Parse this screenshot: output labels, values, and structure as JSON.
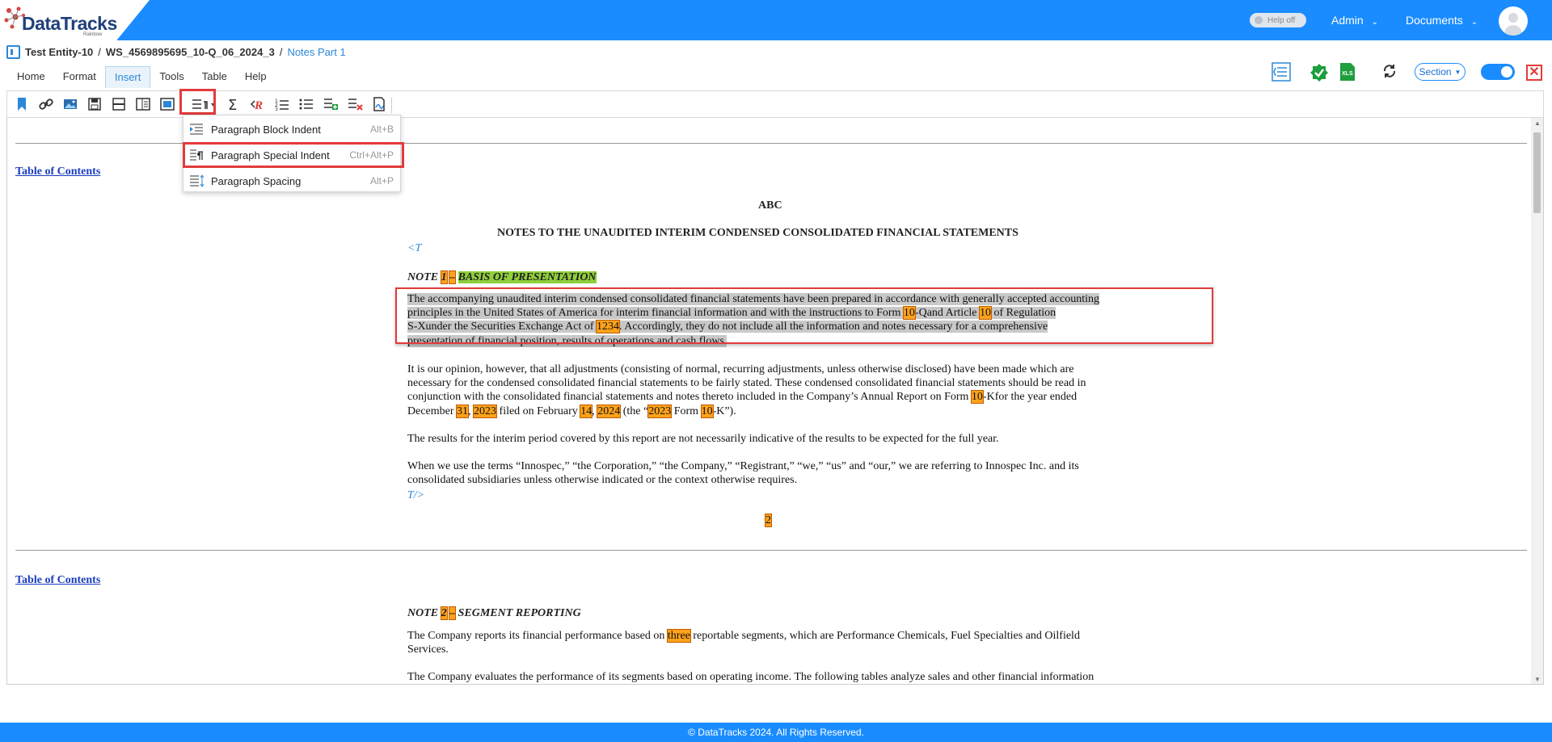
{
  "app": {
    "logo": "DataTracks",
    "logo_sub": "Rainbow",
    "help_toggle": "Help off",
    "admin_menu": "Admin",
    "documents_menu": "Documents"
  },
  "breadcrumb": {
    "entity": "Test Entity-10",
    "workspace": "WS_4569895695_10-Q_06_2024_3",
    "separator1": "/",
    "separator2": "/",
    "current": "Notes Part 1"
  },
  "tabs": [
    "Home",
    "Format",
    "Insert",
    "Tools",
    "Table",
    "Help"
  ],
  "active_tab": "Insert",
  "right_tools": {
    "section_label": "Section"
  },
  "dropdown": {
    "items": [
      {
        "label": "Paragraph Block Indent",
        "shortcut": "Alt+B"
      },
      {
        "label": "Paragraph Special Indent",
        "shortcut": "Ctrl+Alt+P"
      },
      {
        "label": "Paragraph Spacing",
        "shortcut": "Alt+P"
      }
    ]
  },
  "document": {
    "toc1": "Table of Contents",
    "toc2": "Table of Contents",
    "heading_abc": "ABC",
    "heading_notes": "NOTES TO THE UNAUDITED INTERIM CONDENSED CONSOLIDATED FINANCIAL STATEMENTS",
    "tag_open": "<T",
    "tag_close": "T/>",
    "note1_prefix": "NOTE",
    "note1_num": "1",
    "note1_dash": "–",
    "note1_title": "BASIS OF PRESENTATION",
    "p1": {
      "l1": "The accompanying unaudited interim condensed consolidated financial statements have been prepared in accordance with generally accepted accounting",
      "l2a": "principles in the United States of America for interim financial information and with the instructions to Form ",
      "l2b": "10",
      "l2c": "-Qand Article ",
      "l2d": "10",
      "l2e": " of Regulation",
      "l3a": "S-Xunder the Securities Exchange Act of ",
      "l3b": "1234",
      "l3c": ". Accordingly, they do not include all the information and notes necessary for a comprehensive",
      "l4": "presentation of financial position, results of operations and cash flows."
    },
    "p2": {
      "l1": "It is our opinion, however, that all adjustments (consisting of normal, recurring adjustments, unless otherwise disclosed) have been made which are",
      "l2": "necessary for the condensed consolidated financial statements to be fairly stated. These condensed consolidated financial statements should be read in",
      "l3a": "conjunction with the consolidated financial statements and notes thereto included in the Company’s Annual Report on Form ",
      "l3b": "10",
      "l3c": "-Kfor the year ended",
      "l4a": "December ",
      "l4b": "31",
      "l4c": ", ",
      "l4d": "2023",
      "l4e": " filed on February ",
      "l4f": "14",
      "l4g": ", ",
      "l4h": "2024",
      "l4i": " (the “",
      "l4j": "2023",
      "l4k": " Form ",
      "l4l": "10",
      "l4m": "-K”)."
    },
    "p3": "The results for the interim period covered by this report are not necessarily indicative of the results to be expected for the full year.",
    "p4": {
      "l1": "When we use the terms “Innospec,” “the Corporation,” “the Company,” “Registrant,” “we,” “us” and “our,” we are referring to Innospec Inc. and its",
      "l2": "consolidated subsidiaries unless otherwise indicated or the context otherwise requires."
    },
    "page_number": "2",
    "note2_prefix": "NOTE",
    "note2_num": "2",
    "note2_dash": "–",
    "note2_title": "SEGMENT REPORTING",
    "p5": {
      "l1a": "The Company reports its financial performance based on ",
      "l1b": "three",
      "l1c": " reportable segments, which are Performance Chemicals, Fuel Specialties and Oilfield",
      "l2": "Services."
    },
    "p6": "The Company evaluates the performance of its segments based on operating income. The following tables analyze sales and other financial information"
  },
  "footer": "© DataTracks 2024. All Rights Reserved."
}
